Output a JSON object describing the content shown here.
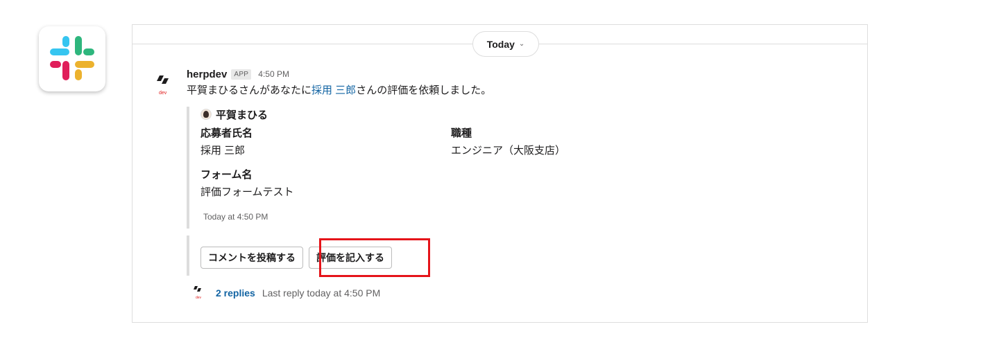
{
  "frame": {
    "date_divider": "Today"
  },
  "message": {
    "sender": "herpdev",
    "badge": "APP",
    "time": "4:50 PM",
    "text_before": "平賀まひるさんがあなたに",
    "mention": "採用 三郎",
    "text_after": "さんの評価を依頼しました。"
  },
  "attachment": {
    "author": "平賀まひる",
    "fields": [
      {
        "label": "応募者氏名",
        "value": "採用 三郎"
      },
      {
        "label": "職種",
        "value": "エンジニア（大阪支店）"
      },
      {
        "label": "フォーム名",
        "value": "評価フォームテスト"
      }
    ],
    "footer": "Today at 4:50 PM"
  },
  "actions": {
    "comment_button": "コメントを投稿する",
    "evaluate_button": "評価を記入する"
  },
  "thread": {
    "replies": "2 replies",
    "last_reply": "Last reply today at 4:50 PM"
  },
  "colors": {
    "link": "#1264a3",
    "highlight": "#e5141a",
    "slack_blue": "#36c5f0",
    "slack_green": "#2eb67d",
    "slack_yellow": "#ecb22e",
    "slack_red": "#e01e5a"
  },
  "icons": {
    "app_logo": "slack-logo-icon",
    "date_chevron": "chevron-down-icon",
    "bot_avatar": "herp-logo-icon"
  }
}
